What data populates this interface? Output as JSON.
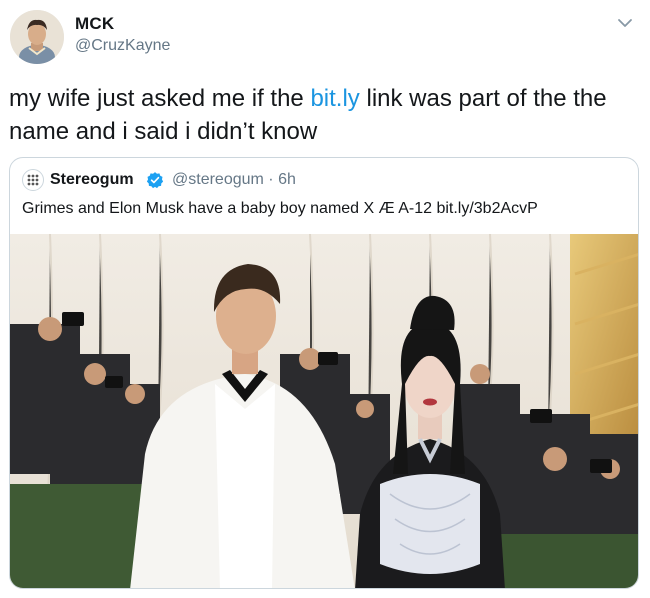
{
  "tweet": {
    "display_name": "MCK",
    "handle": "@CruzKayne",
    "text_before": "my wife just asked me if the ",
    "link_text": "bit.ly",
    "text_after": " link was part of the the name and i said i didn’t know"
  },
  "quoted_tweet": {
    "display_name": "Stereogum",
    "handle": "@stereogum",
    "separator": " · ",
    "time": "6h",
    "text": "Grimes and Elon Musk have a baby boy named X Æ A-12 bit.ly/3b2AcvP"
  },
  "icons": {
    "more": "chevron-down-icon",
    "verified": "verified-badge-icon"
  },
  "colors": {
    "link": "#1b95e0",
    "verified": "#1da1f2",
    "secondary_text": "#657786",
    "border": "#ccd6dd"
  }
}
